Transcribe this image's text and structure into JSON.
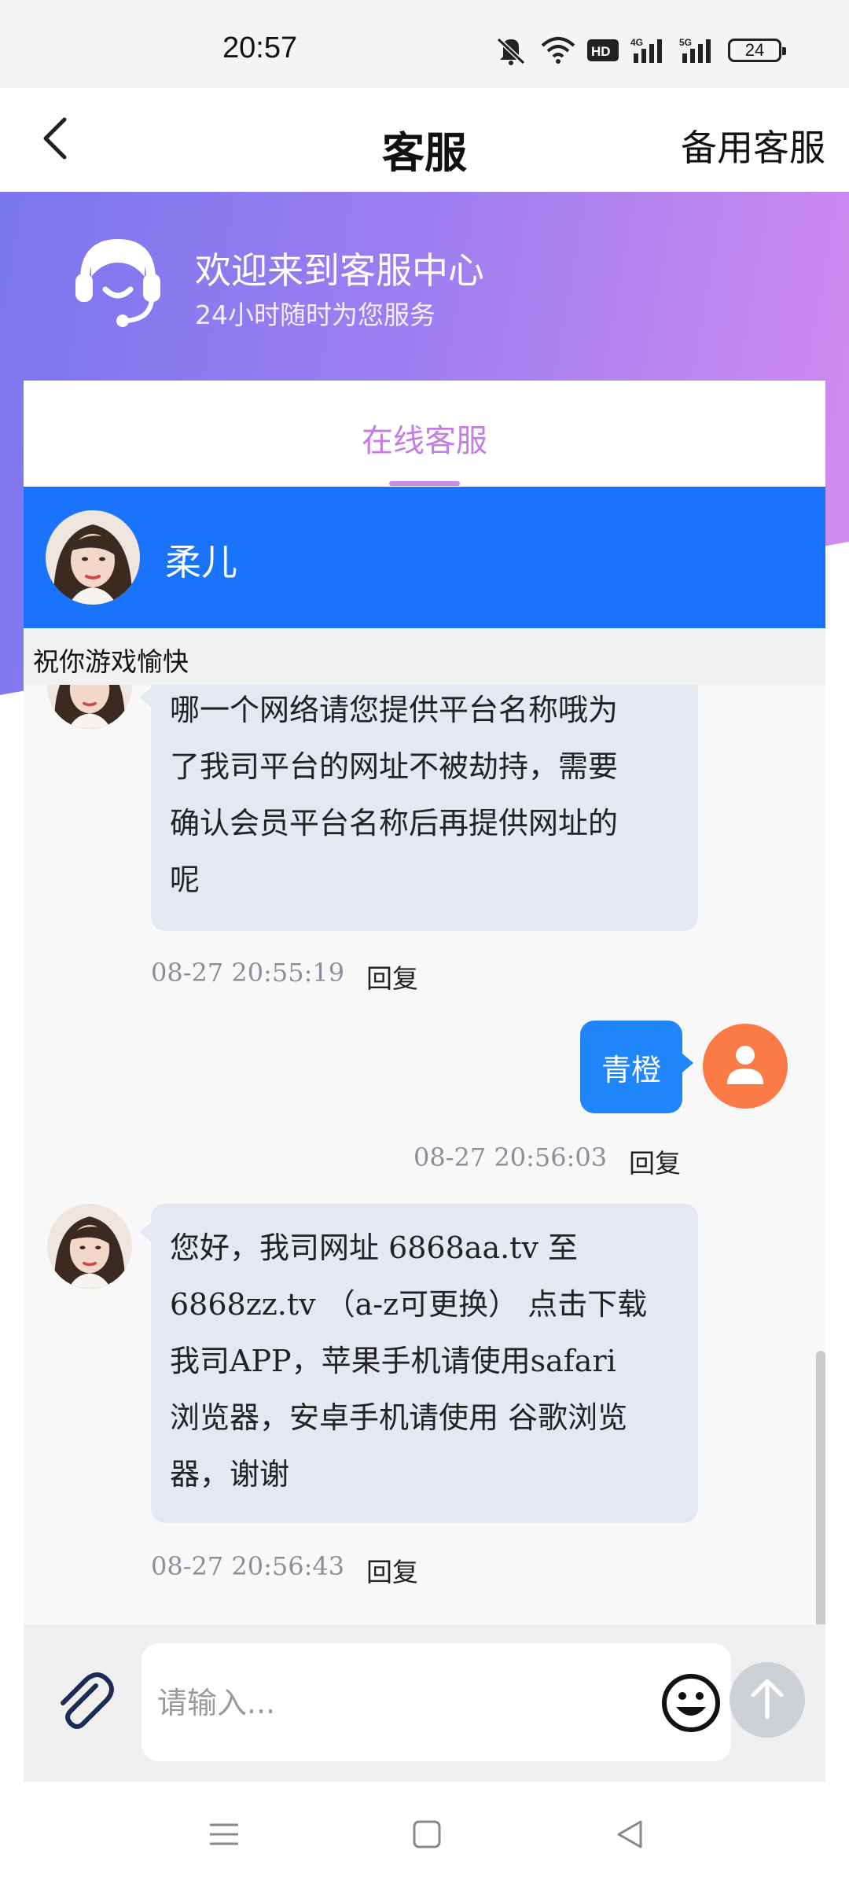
{
  "status_bar": {
    "time": "20:57",
    "battery": "24",
    "icons": [
      "mute-icon",
      "wifi-icon",
      "hd-icon",
      "4g-signal-icon",
      "5g-signal-icon",
      "battery-icon"
    ]
  },
  "header": {
    "title": "客服",
    "back_icon": "chevron-left-icon",
    "right_action": "备用客服"
  },
  "hero": {
    "title": "欢迎来到客服中心",
    "subtitle": "24小时随时为您服务",
    "icon": "headset-icon",
    "gradient": [
      "#7b76ee",
      "#d48bf0"
    ]
  },
  "tabs": [
    {
      "label": "在线客服",
      "active": true
    }
  ],
  "agent": {
    "name": "柔儿",
    "notice": "祝你游戏愉快",
    "bar_color": "#1a73fb"
  },
  "messages": [
    {
      "from": "agent",
      "lines": [
        "哪一个网络请您提供平台名称哦为",
        "了我司平台的网址不被劫持，需要",
        "确认会员平台名称后再提供网址的",
        "呢"
      ],
      "time": "08-27 20:55:19",
      "reply": "回复"
    },
    {
      "from": "user",
      "text": "青橙",
      "time": "08-27 20:56:03",
      "reply": "回复"
    },
    {
      "from": "agent",
      "lines": [
        "您好，我司网址 6868aa.tv 至",
        "6868zz.tv （a-z可更换） 点击下载",
        "我司APP，苹果手机请使用safari",
        "浏览器，安卓手机请使用 谷歌浏览",
        "器，谢谢"
      ],
      "time": "08-27 20:56:43",
      "reply": "回复"
    }
  ],
  "input": {
    "placeholder": "请输入...",
    "value": "",
    "attach_icon": "paperclip-icon",
    "emoji_icon": "smiley-icon",
    "send_icon": "arrow-up-icon"
  },
  "nav_bar": {
    "icons": [
      "menu-icon",
      "home-square-icon",
      "back-triangle-icon"
    ]
  },
  "colors": {
    "accent_purple": "#c57de6",
    "user_bubble": "#1f86fc",
    "agent_bubble": "#e3e8f1",
    "user_avatar": "#fb7a45"
  }
}
